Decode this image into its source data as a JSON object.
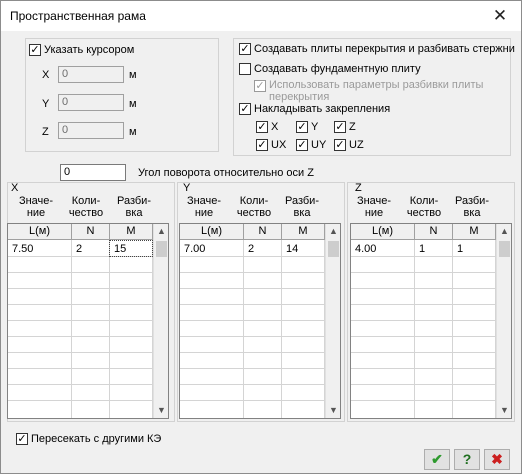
{
  "window": {
    "title": "Пространственная рама"
  },
  "cursor_group": {
    "checkbox_label": "Указать курсором",
    "checked": true,
    "fields": [
      {
        "label": "X",
        "value": "0",
        "unit": "м"
      },
      {
        "label": "Y",
        "value": "0",
        "unit": "м"
      },
      {
        "label": "Z",
        "value": "0",
        "unit": "м"
      }
    ]
  },
  "options": {
    "create_slabs": {
      "label": "Создавать плиты перекрытия и разбивать стержни",
      "checked": true
    },
    "create_foundation": {
      "label": "Создавать фундаментную плиту",
      "checked": false
    },
    "use_split_params": {
      "label_line1": "Использовать параметры разбивки плиты",
      "label_line2": "перекрытия",
      "checked": true,
      "disabled": true
    },
    "apply_constraints": {
      "label": "Накладывать закрепления",
      "checked": true
    },
    "constraints": [
      {
        "label": "X",
        "checked": true
      },
      {
        "label": "Y",
        "checked": true
      },
      {
        "label": "Z",
        "checked": true
      },
      {
        "label": "UX",
        "checked": true
      },
      {
        "label": "UY",
        "checked": true
      },
      {
        "label": "UZ",
        "checked": true
      }
    ]
  },
  "rotation": {
    "value": "0",
    "label": "Угол поворота относительно оси Z"
  },
  "tables": [
    {
      "axis": "X",
      "col_titles": [
        "Значе-\nние",
        "Коли-\nчество",
        "Разби-\nвка"
      ],
      "headers": [
        "L(м)",
        "N",
        "M"
      ],
      "row": [
        "7.50",
        "2",
        "15"
      ]
    },
    {
      "axis": "Y",
      "col_titles": [
        "Значе-\nние",
        "Коли-\nчество",
        "Разби-\nвка"
      ],
      "headers": [
        "L(м)",
        "N",
        "M"
      ],
      "row": [
        "7.00",
        "2",
        "14"
      ]
    },
    {
      "axis": "Z",
      "col_titles": [
        "Значе-\nние",
        "Коли-\nчество",
        "Разби-\nвка"
      ],
      "headers": [
        "L(м)",
        "N",
        "M"
      ],
      "row": [
        "4.00",
        "1",
        "1"
      ]
    }
  ],
  "intersect": {
    "label": "Пересекать с другими КЭ",
    "checked": true
  },
  "buttons": {
    "ok_icon": "checkmark-icon",
    "help_icon": "question-icon",
    "cancel_icon": "cross-icon",
    "ok_glyph": "✔",
    "help_glyph": "?",
    "cancel_glyph": "✖",
    "ok_color": "#2e9a2e",
    "help_color": "#1f6f1f",
    "cancel_color": "#cc1f1f"
  }
}
